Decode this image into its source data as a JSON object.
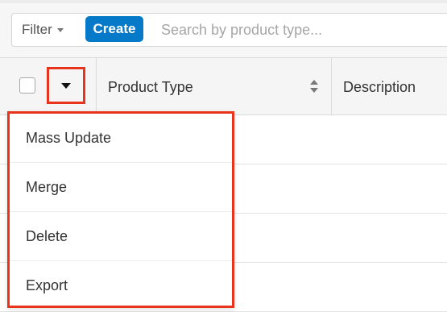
{
  "filter_bar": {
    "filter_label": "Filter",
    "create_label": "Create",
    "search_placeholder": "Search by product type..."
  },
  "table": {
    "columns": [
      {
        "label": "Product Type",
        "sortable": true
      },
      {
        "label": "Description",
        "sortable": false
      }
    ],
    "row_partial_link": "t"
  },
  "actions_menu": {
    "items": [
      {
        "label": "Mass Update"
      },
      {
        "label": "Merge"
      },
      {
        "label": "Delete"
      },
      {
        "label": "Export"
      }
    ]
  },
  "colors": {
    "brand_blue": "#0679c8",
    "highlight_red": "#e8341c"
  },
  "icons": {
    "filter_caret": "caret-down-icon",
    "actions_caret": "caret-down-icon",
    "sort": "sort-icon"
  }
}
